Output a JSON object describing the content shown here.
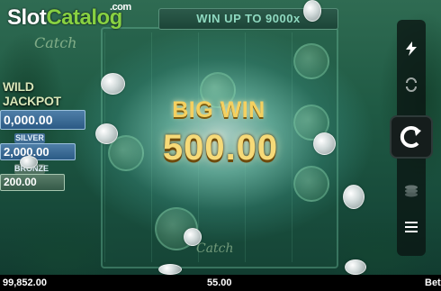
{
  "watermark": {
    "brand_slot": "Slot",
    "brand_catalog": "Catalog",
    "brand_tld": ".com"
  },
  "game": {
    "logo_fragment_top": "Catch",
    "logo_fragment_bottom": "Catch",
    "win_up_to": "WIN UP TO 9000x"
  },
  "jackpots": {
    "title": "WILD JACKPOT",
    "grand_value": "0,000.00",
    "silver_label": "SILVER",
    "silver_value": "2,000.00",
    "bronze_label": "BRONZE",
    "bronze_value": "200.00"
  },
  "win_overlay": {
    "label": "BIG WIN",
    "amount": "500.00"
  },
  "controls": {
    "turbo_icon": "lightning-icon",
    "autoplay_icon": "autoplay-icon",
    "spin_icon": "spin-icon",
    "coins_icon": "coins-stack-icon",
    "menu_icon": "menu-icon"
  },
  "status_bar": {
    "balance": "99,852.00",
    "win": "55.00",
    "bet_label": "Bet"
  },
  "colors": {
    "win_gold": "#f6da78",
    "brand_green": "#88d142",
    "jackpot_blue": "#2b5a85"
  }
}
